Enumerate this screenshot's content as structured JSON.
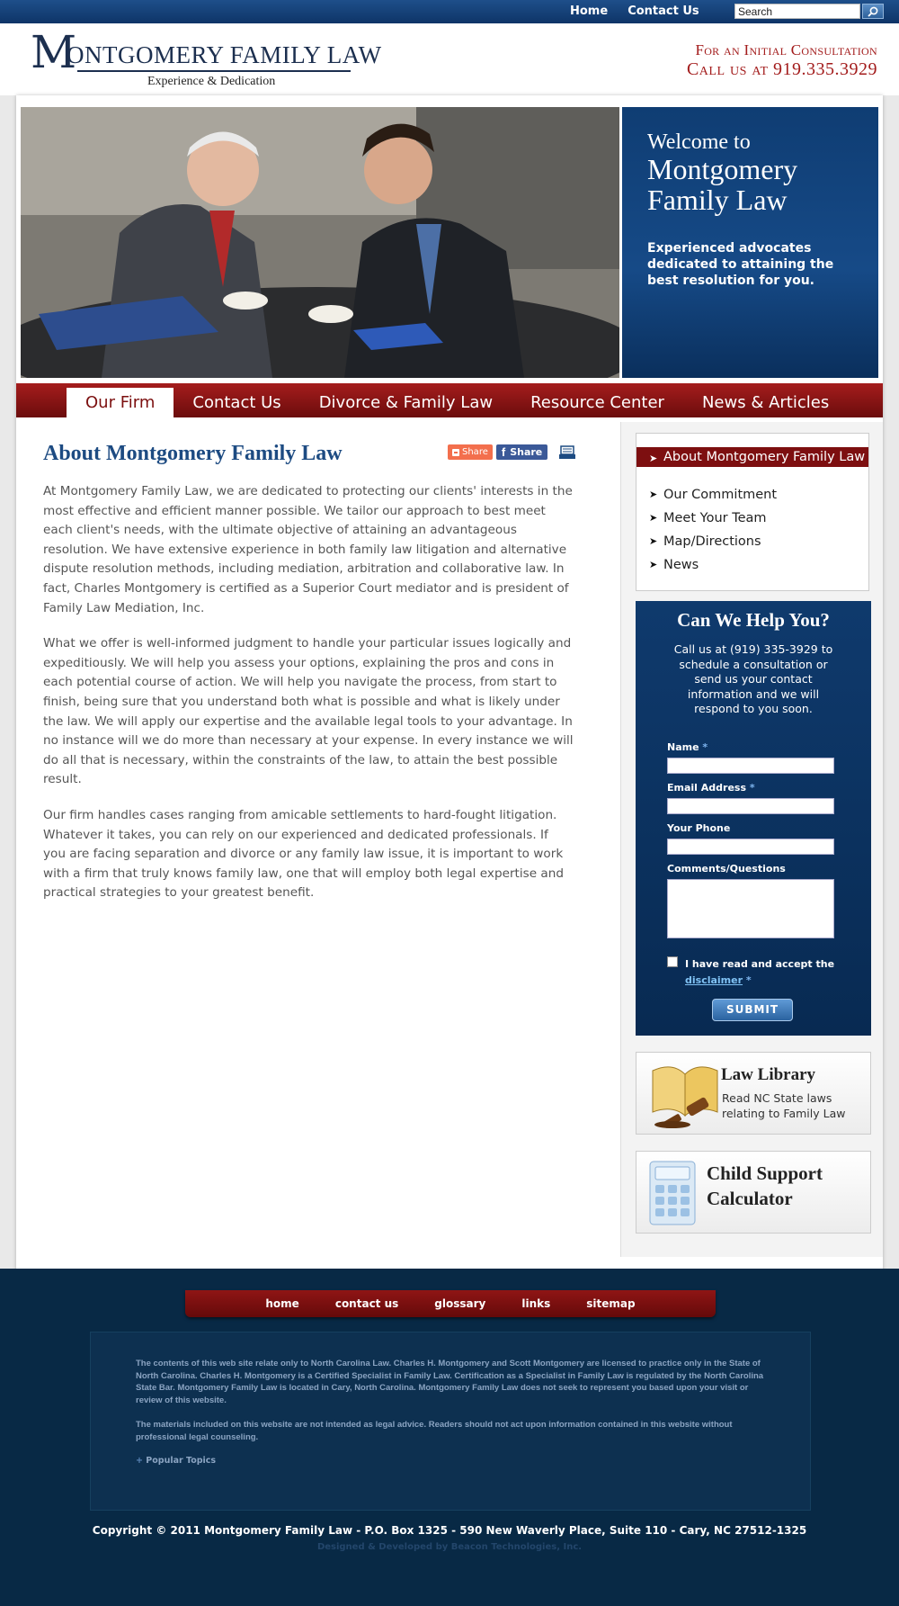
{
  "topnav": {
    "home": "Home",
    "contact": "Contact Us",
    "search_placeholder": "Search"
  },
  "header": {
    "logo_name": "ONTGOMERY FAMILY LAW",
    "logo_monogram": "M",
    "tagline": "Experience & Dedication",
    "consult_line1": "For an Initial Consultation",
    "consult_line2": "Call us at 919.335.3929"
  },
  "welcome": {
    "line1": "Welcome to",
    "line2": "Montgomery",
    "line3": "Family Law",
    "desc": "Experienced advocates dedicated to attaining the best resolution for you."
  },
  "mainnav": {
    "tabs": [
      "Our Firm",
      "Contact Us",
      "Divorce & Family Law",
      "Resource Center",
      "News & Articles"
    ]
  },
  "content": {
    "title": "About Montgomery Family Law",
    "share_label": "Share",
    "fb_share_label": "Share",
    "paragraphs": [
      "At Montgomery Family Law, we are dedicated to protecting our clients' interests in the most effective and efficient manner possible. We tailor our approach to best meet each client's needs, with the ultimate objective of attaining an advantageous resolution. We have extensive experience in both family law litigation and alternative dispute resolution methods, including mediation, arbitration and collaborative law. In fact, Charles Montgomery is certified as a Superior Court mediator and is president of Family Law Mediation, Inc.",
      "What we offer is well-informed judgment to handle your particular issues logically and expeditiously. We will help you assess your options, explaining the pros and cons in each potential course of action. We will help you navigate the process, from start to finish, being sure that you understand both what is possible and what is likely under the law. We will apply our expertise and the available legal tools to your advantage. In no instance will we do more than necessary at your expense. In every instance we will do all that is necessary, within the constraints of the law, to attain the best possible result.",
      "Our firm handles cases ranging from amicable settlements to hard-fought litigation. Whatever it takes, you can rely on our experienced and dedicated professionals. If you are facing separation and divorce or any family law issue, it is important to work with a firm that truly knows family law, one that will employ both legal expertise and practical strategies to your greatest benefit."
    ]
  },
  "subnav": {
    "items": [
      "About Montgomery Family Law",
      "Our Commitment",
      "Meet Your Team",
      "Map/Directions",
      "News"
    ]
  },
  "help": {
    "title": "Can We Help You?",
    "desc": "Call us at (919) 335-3929 to schedule a consultation or send us your contact information and we will respond to you soon.",
    "name_label": "Name",
    "email_label": "Email Address",
    "phone_label": "Your Phone",
    "comments_label": "Comments/Questions",
    "required_mark": "*",
    "accept_text": "I have read and accept the",
    "disclaimer_link": "disclaimer",
    "submit": "SUBMIT"
  },
  "promos": {
    "library_title": "Law Library",
    "library_sub": "Read NC State laws relating to Family Law",
    "calc_title_1": "Child Support",
    "calc_title_2": "Calculator"
  },
  "footer": {
    "nav": [
      "home",
      "contact us",
      "glossary",
      "links",
      "sitemap"
    ],
    "disclaimer_1": "The contents of this web site relate only to North Carolina Law. Charles H. Montgomery and Scott Montgomery are licensed to practice only in the State of North Carolina. Charles H. Montgomery is a Certified Specialist in Family Law. Certification as a Specialist in Family Law is regulated by the North Carolina State Bar. Montgomery Family Law is located in Cary, North Carolina. Montgomery Family Law does not seek to represent you based upon your visit or review of this website.",
    "disclaimer_2": "The materials included on this website are not intended as legal advice. Readers should not act upon information contained in this website without professional legal counseling.",
    "popular": "Popular Topics",
    "copyright": "Copyright © 2011 Montgomery Family Law - P.O. Box 1325 - 590 New Waverly Place, Suite 110 - Cary, NC 27512-1325",
    "designed": "Designed & Developed by Beacon Technologies, Inc."
  },
  "colors": {
    "brand_blue": "#0f3d73",
    "brand_red": "#7d0f10",
    "footer_bg": "#082945"
  }
}
